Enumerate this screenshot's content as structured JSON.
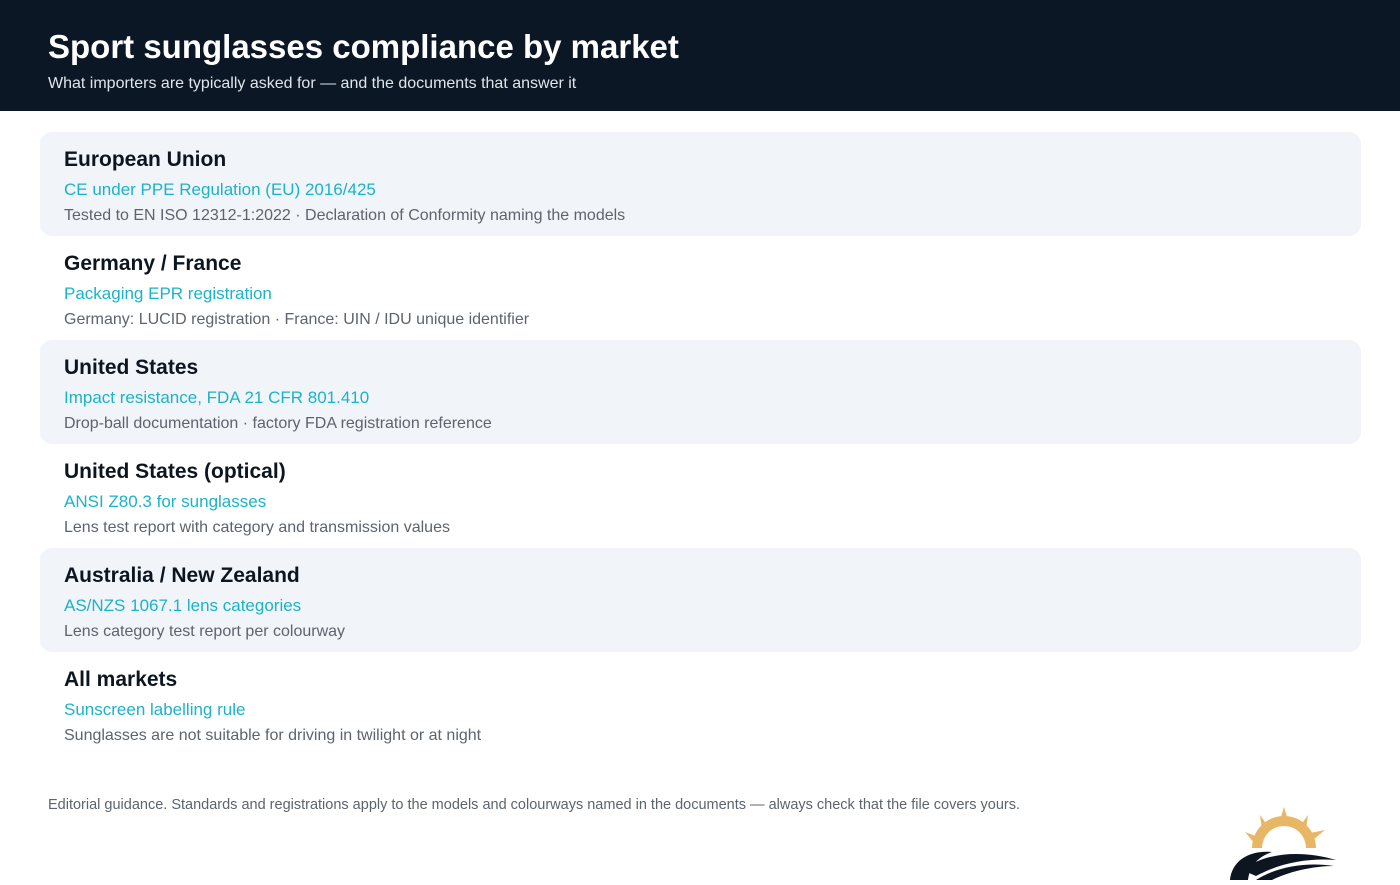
{
  "header": {
    "title": "Sport sunglasses compliance by market",
    "subtitle": "What importers are typically asked for — and the documents that answer it"
  },
  "markets": [
    {
      "name": "European Union",
      "requirement": "CE under PPE Regulation (EU) 2016/425",
      "documents": "Tested to EN ISO 12312-1:2022 · Declaration of Conformity naming the models"
    },
    {
      "name": "Germany / France",
      "requirement": "Packaging EPR registration",
      "documents": "Germany: LUCID registration · France: UIN / IDU unique identifier"
    },
    {
      "name": "United States",
      "requirement": "Impact resistance, FDA 21 CFR 801.410",
      "documents": "Drop-ball documentation · factory FDA registration reference"
    },
    {
      "name": "United States (optical)",
      "requirement": "ANSI Z80.3 for sunglasses",
      "documents": "Lens test report with category and transmission values"
    },
    {
      "name": "Australia / New Zealand",
      "requirement": "AS/NZS 1067.1 lens categories",
      "documents": "Lens category test report per colourway"
    },
    {
      "name": "All markets",
      "requirement": "Sunscreen labelling rule",
      "documents": "Sunglasses are not suitable for driving in twilight or at night"
    }
  ],
  "footnote": "Editorial guidance. Standards and registrations apply to the models and colourways named in the documents — always check that the file covers yours.",
  "colors": {
    "header_background": "#0b1724",
    "requirement_text": "#1bb3c7",
    "row_shade": "#f1f4f8",
    "logo_sun": "#e8b765",
    "logo_wave": "#0d1620"
  },
  "logo": {
    "icon": "sun-over-waves-logo"
  }
}
